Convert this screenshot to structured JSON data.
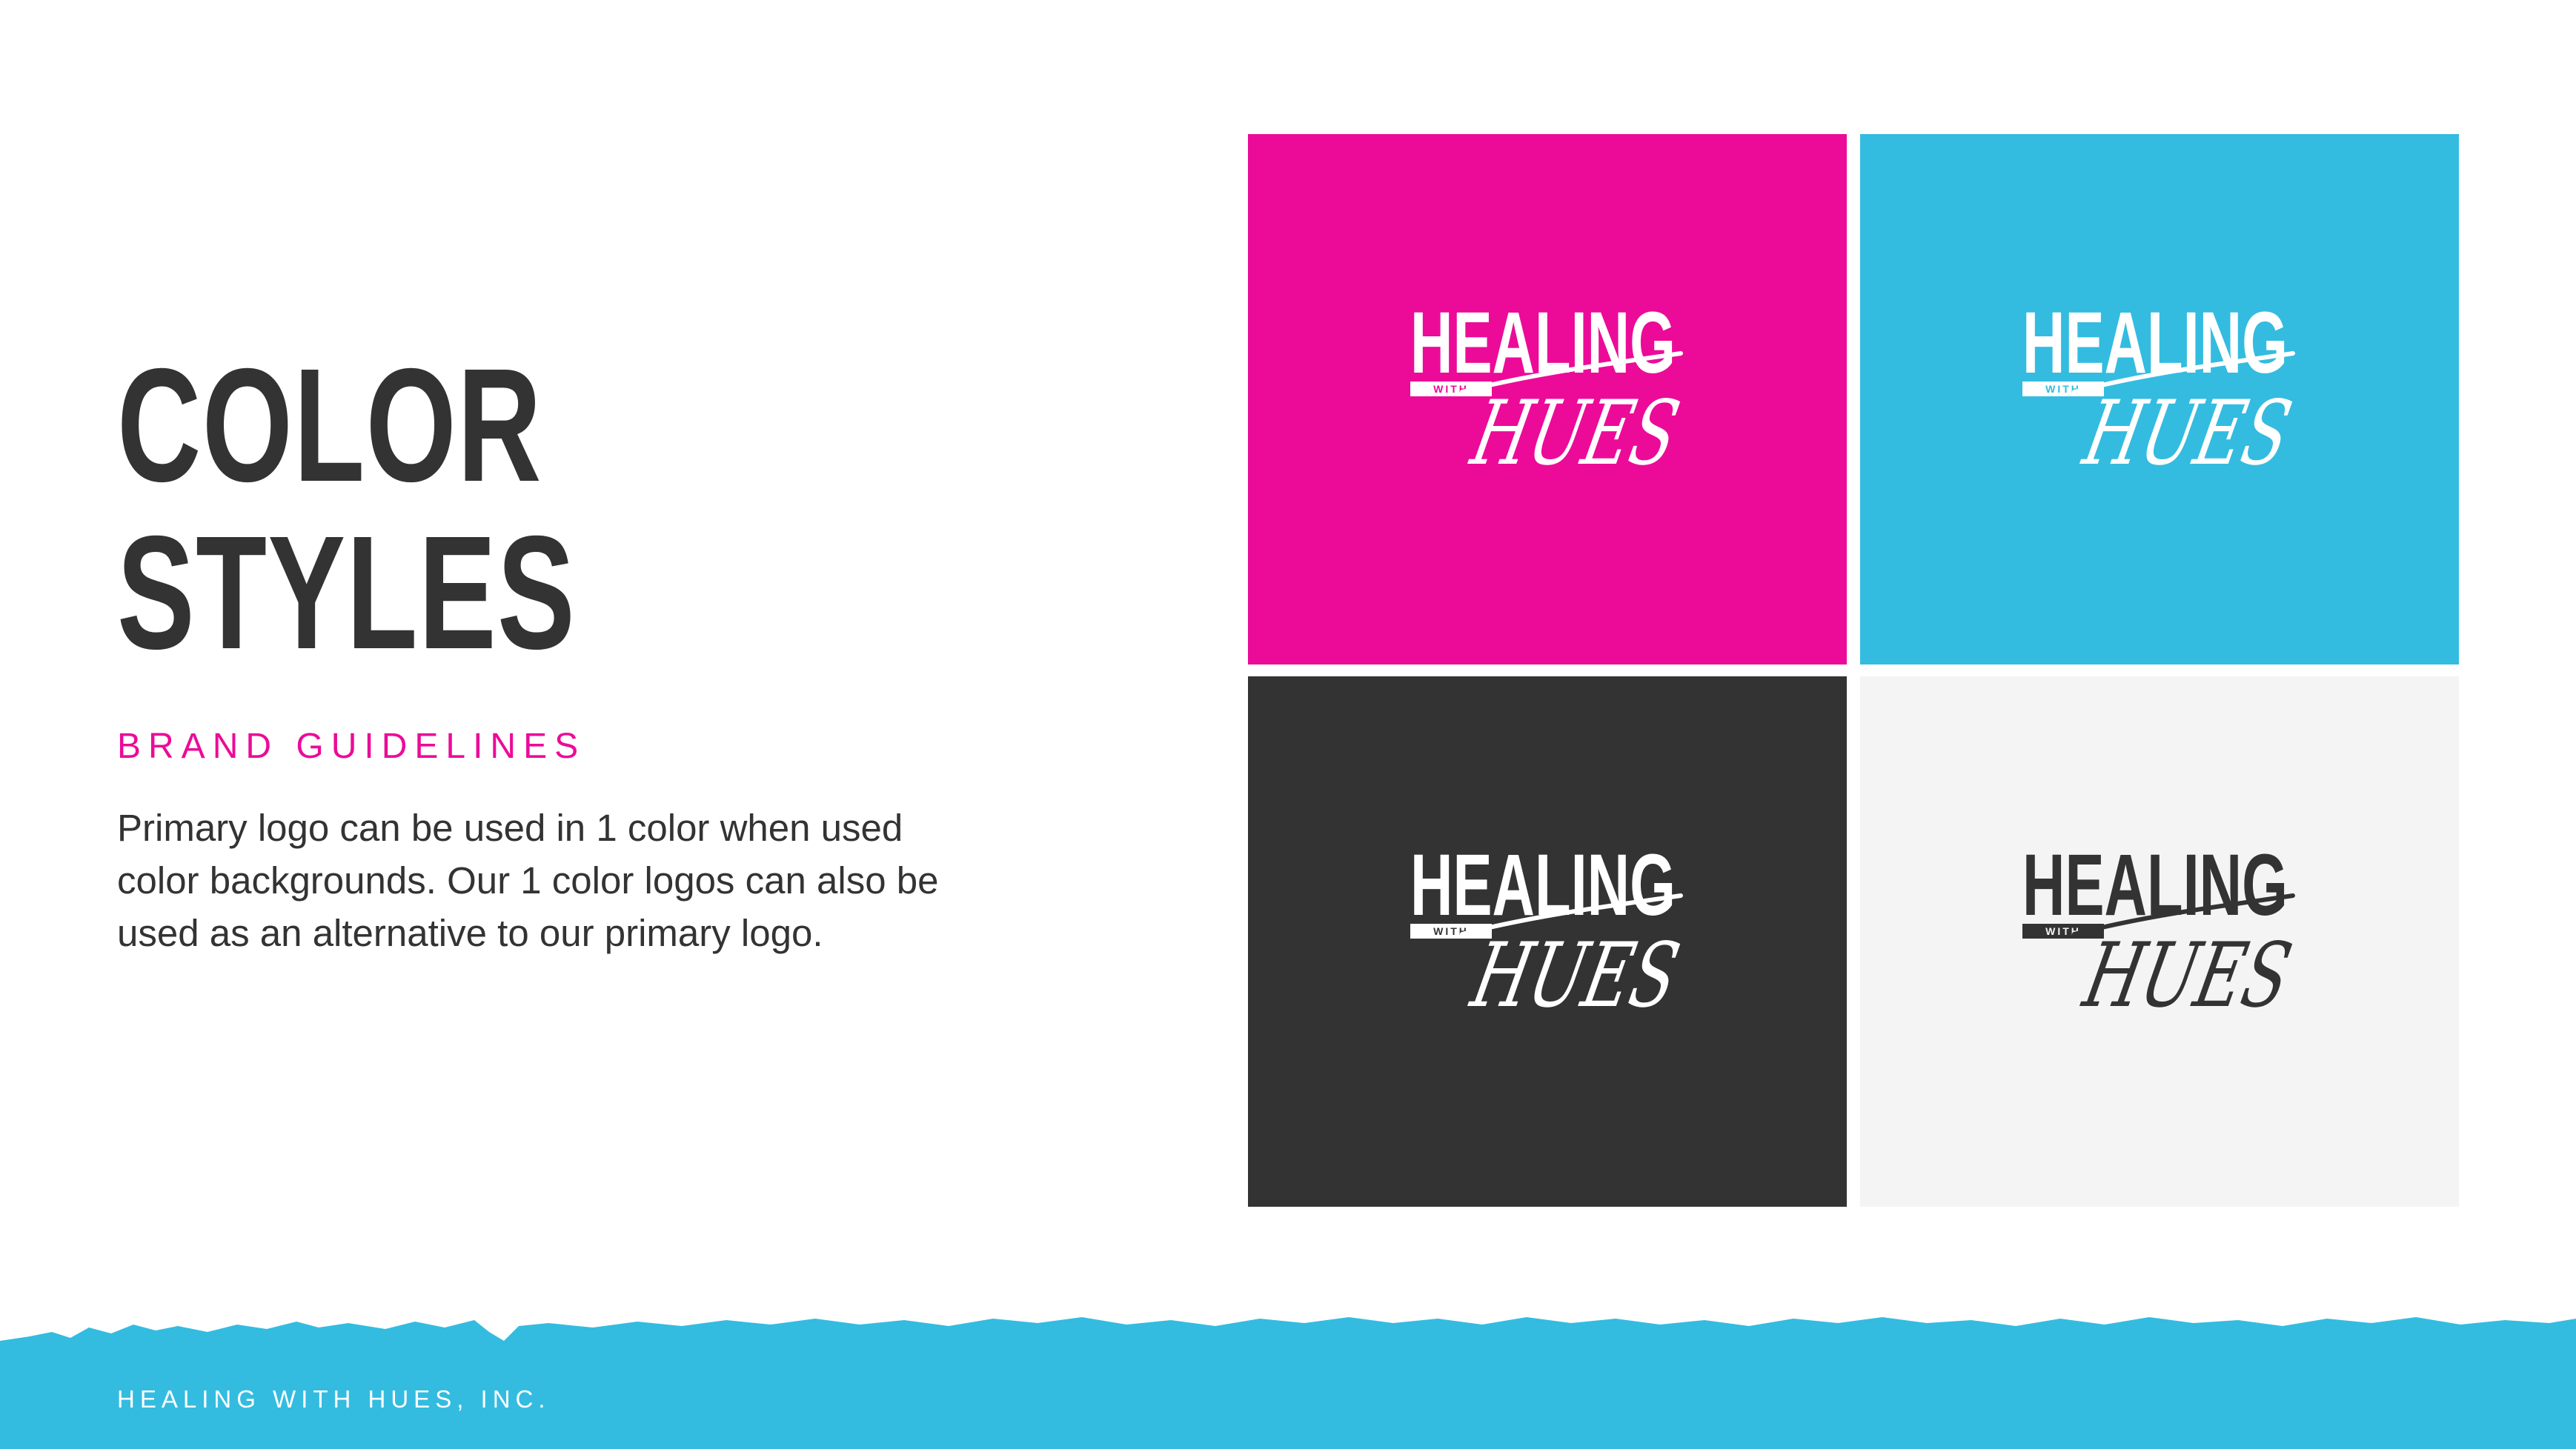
{
  "colors": {
    "accent_magenta": "#ec0b98",
    "accent_cyan": "#33bce0",
    "dark": "#333333",
    "light": "#f4f4f4",
    "white": "#ffffff"
  },
  "page": {
    "title_line1": "COLOR",
    "title_line2": "STYLES",
    "subtitle": "BRAND GUIDELINES",
    "description": "Primary logo can be used in 1 color when used color backgrounds. Our 1 color logos can also be used as an alternative to our primary logo."
  },
  "logo_variants": [
    {
      "background": "#ec0b98",
      "logo_color": "#ffffff",
      "logo_text": {
        "word1": "HEALING",
        "word2": "WITH",
        "word3": "HUES"
      }
    },
    {
      "background": "#33bce0",
      "logo_color": "#ffffff",
      "logo_text": {
        "word1": "HEALING",
        "word2": "WITH",
        "word3": "HUES"
      }
    },
    {
      "background": "#333333",
      "logo_color": "#ffffff",
      "logo_text": {
        "word1": "HEALING",
        "word2": "WITH",
        "word3": "HUES"
      }
    },
    {
      "background": "#f4f4f4",
      "logo_color": "#333333",
      "logo_text": {
        "word1": "HEALING",
        "word2": "WITH",
        "word3": "HUES"
      }
    }
  ],
  "footer": {
    "company": "HEALING WITH HUES, INC."
  }
}
